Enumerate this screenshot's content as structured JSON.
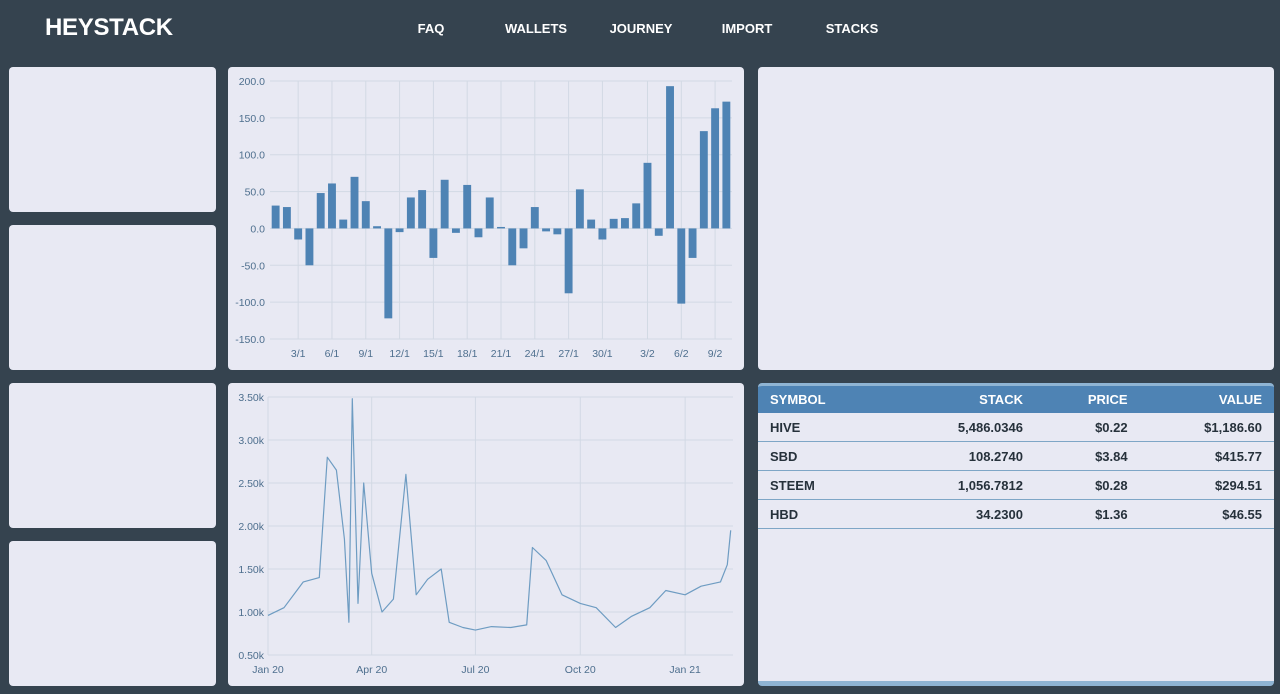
{
  "app": {
    "logo": "HEYSTACK"
  },
  "nav": {
    "items": [
      "FAQ",
      "WALLETS",
      "JOURNEY",
      "IMPORT",
      "STACKS"
    ]
  },
  "colors": {
    "background": "#35434f",
    "panel": "#e8e9f3",
    "accent": "#4e83b4",
    "line": "#6e9cc2"
  },
  "bar_chart": {
    "title": "",
    "ylim": [
      -150,
      200
    ],
    "yticks": [
      "200.0",
      "150.0",
      "100.0",
      "50.0",
      "0.0",
      "-50.0",
      "-100.0",
      "-150.0"
    ],
    "xticks": [
      "3/1",
      "6/1",
      "9/1",
      "12/1",
      "15/1",
      "18/1",
      "21/1",
      "24/1",
      "27/1",
      "30/1",
      "3/2",
      "6/2",
      "9/2"
    ]
  },
  "line_chart": {
    "yticks": [
      "3.50k",
      "3.00k",
      "2.50k",
      "2.00k",
      "1.50k",
      "1.00k",
      "0.50k"
    ],
    "xticks": [
      "Jan 20",
      "Apr 20",
      "Jul 20",
      "Oct 20",
      "Jan 21"
    ]
  },
  "chart_data": [
    {
      "type": "bar",
      "categories": [
        "1/1",
        "2/1",
        "3/1",
        "4/1",
        "5/1",
        "6/1",
        "7/1",
        "8/1",
        "9/1",
        "10/1",
        "11/1",
        "12/1",
        "13/1",
        "14/1",
        "15/1",
        "16/1",
        "17/1",
        "18/1",
        "19/1",
        "20/1",
        "21/1",
        "22/1",
        "23/1",
        "24/1",
        "25/1",
        "26/1",
        "27/1",
        "28/1",
        "29/1",
        "30/1",
        "31/1",
        "1/2",
        "2/2",
        "3/2",
        "4/2",
        "5/2",
        "6/2",
        "7/2",
        "8/2",
        "9/2",
        "10/2"
      ],
      "values": [
        31,
        29,
        -15,
        -50,
        48,
        61,
        12,
        70,
        37,
        3,
        -122,
        -5,
        42,
        52,
        -40,
        66,
        -6,
        59,
        -12,
        42,
        2,
        -50,
        -27,
        29,
        -4,
        -8,
        -88,
        53,
        12,
        -15,
        13,
        14,
        34,
        89,
        -10,
        193,
        -102,
        -40,
        132,
        163,
        172
      ],
      "ylim": [
        -150,
        200
      ],
      "title": "",
      "xlabel": "",
      "ylabel": "",
      "grid": true
    },
    {
      "type": "line",
      "x": [
        "2020-01-01",
        "2020-01-15",
        "2020-02-01",
        "2020-02-15",
        "2020-02-22",
        "2020-03-01",
        "2020-03-08",
        "2020-03-12",
        "2020-03-15",
        "2020-03-20",
        "2020-03-25",
        "2020-04-01",
        "2020-04-10",
        "2020-04-20",
        "2020-05-01",
        "2020-05-10",
        "2020-05-20",
        "2020-06-01",
        "2020-06-08",
        "2020-06-20",
        "2020-07-01",
        "2020-07-15",
        "2020-08-01",
        "2020-08-15",
        "2020-08-20",
        "2020-09-01",
        "2020-09-15",
        "2020-10-01",
        "2020-10-15",
        "2020-11-01",
        "2020-11-15",
        "2020-12-01",
        "2020-12-15",
        "2021-01-01",
        "2021-01-15",
        "2021-02-01",
        "2021-02-07",
        "2021-02-10"
      ],
      "y": [
        960,
        1050,
        1350,
        1400,
        2800,
        2650,
        1850,
        880,
        3480,
        1100,
        2500,
        1450,
        1000,
        1150,
        2600,
        1200,
        1380,
        1500,
        880,
        820,
        790,
        830,
        820,
        850,
        1750,
        1600,
        1200,
        1100,
        1050,
        820,
        950,
        1050,
        1250,
        1200,
        1300,
        1350,
        1550,
        1950
      ],
      "ylim": [
        500,
        3500
      ],
      "xlim": [
        "2020-01-01",
        "2021-02-12"
      ],
      "title": "",
      "xlabel": "",
      "ylabel": "",
      "grid": true
    }
  ],
  "stack_table": {
    "headers": [
      "SYMBOL",
      "STACK",
      "PRICE",
      "VALUE"
    ],
    "rows": [
      {
        "symbol": "HIVE",
        "stack": "5,486.0346",
        "price": "$0.22",
        "value": "$1,186.60"
      },
      {
        "symbol": "SBD",
        "stack": "108.2740",
        "price": "$3.84",
        "value": "$415.77"
      },
      {
        "symbol": "STEEM",
        "stack": "1,056.7812",
        "price": "$0.28",
        "value": "$294.51"
      },
      {
        "symbol": "HBD",
        "stack": "34.2300",
        "price": "$1.36",
        "value": "$46.55"
      }
    ]
  }
}
